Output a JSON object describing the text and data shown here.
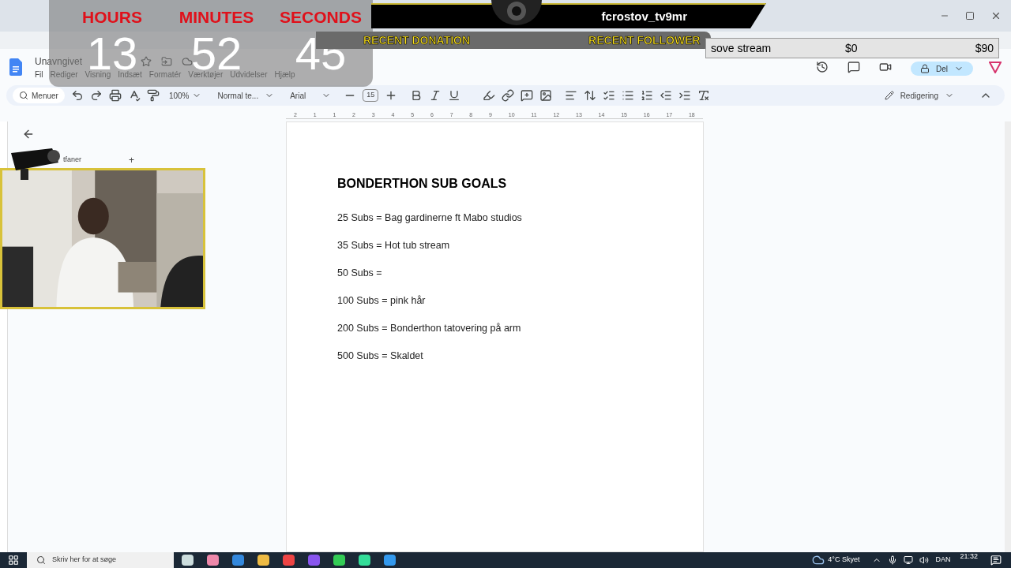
{
  "overlay": {
    "timer": [
      {
        "label": "HOURS",
        "value": "13"
      },
      {
        "label": "MINUTES",
        "value": "52"
      },
      {
        "label": "SECONDS",
        "value": "45"
      }
    ],
    "username": "fcrostov_tv9mr",
    "recent_donation": "RECENT DONATION",
    "recent_follower": "RECENT FOLLOWER",
    "goal": {
      "name": "sove stream",
      "current": "$0",
      "target": "$90"
    }
  },
  "docs": {
    "title": "Unavngivet",
    "menu": [
      "Fil",
      "Rediger",
      "Visning",
      "Indsæt",
      "Formatér",
      "Værktøjer",
      "Udvidelser",
      "Hjælp"
    ],
    "share": "Del",
    "toolbar": {
      "search": "Menuer",
      "zoom": "100%",
      "style": "Normal te...",
      "font": "Arial",
      "size": "15",
      "mode": "Redigering"
    },
    "ruler": [
      "2",
      "1",
      "1",
      "2",
      "3",
      "4",
      "5",
      "6",
      "7",
      "8",
      "9",
      "10",
      "11",
      "12",
      "13",
      "14",
      "15",
      "16",
      "17",
      "18"
    ],
    "sidebar": {
      "tabs_label": "tfaner",
      "add": "+"
    },
    "document": {
      "heading": "BONDERTHON SUB GOALS",
      "lines": [
        "25 Subs = Bag gardinerne ft Mabo studios",
        "35 Subs = Hot tub stream",
        "50 Subs =",
        "100 Subs = pink hår",
        "200 Subs = Bonderthon tatovering på arm",
        "500 Subs = Skaldet"
      ]
    }
  },
  "taskbar": {
    "search": "Skriv her for at søge",
    "weather": "4°C  Skyet",
    "language": "DAN",
    "time": "21:32"
  }
}
